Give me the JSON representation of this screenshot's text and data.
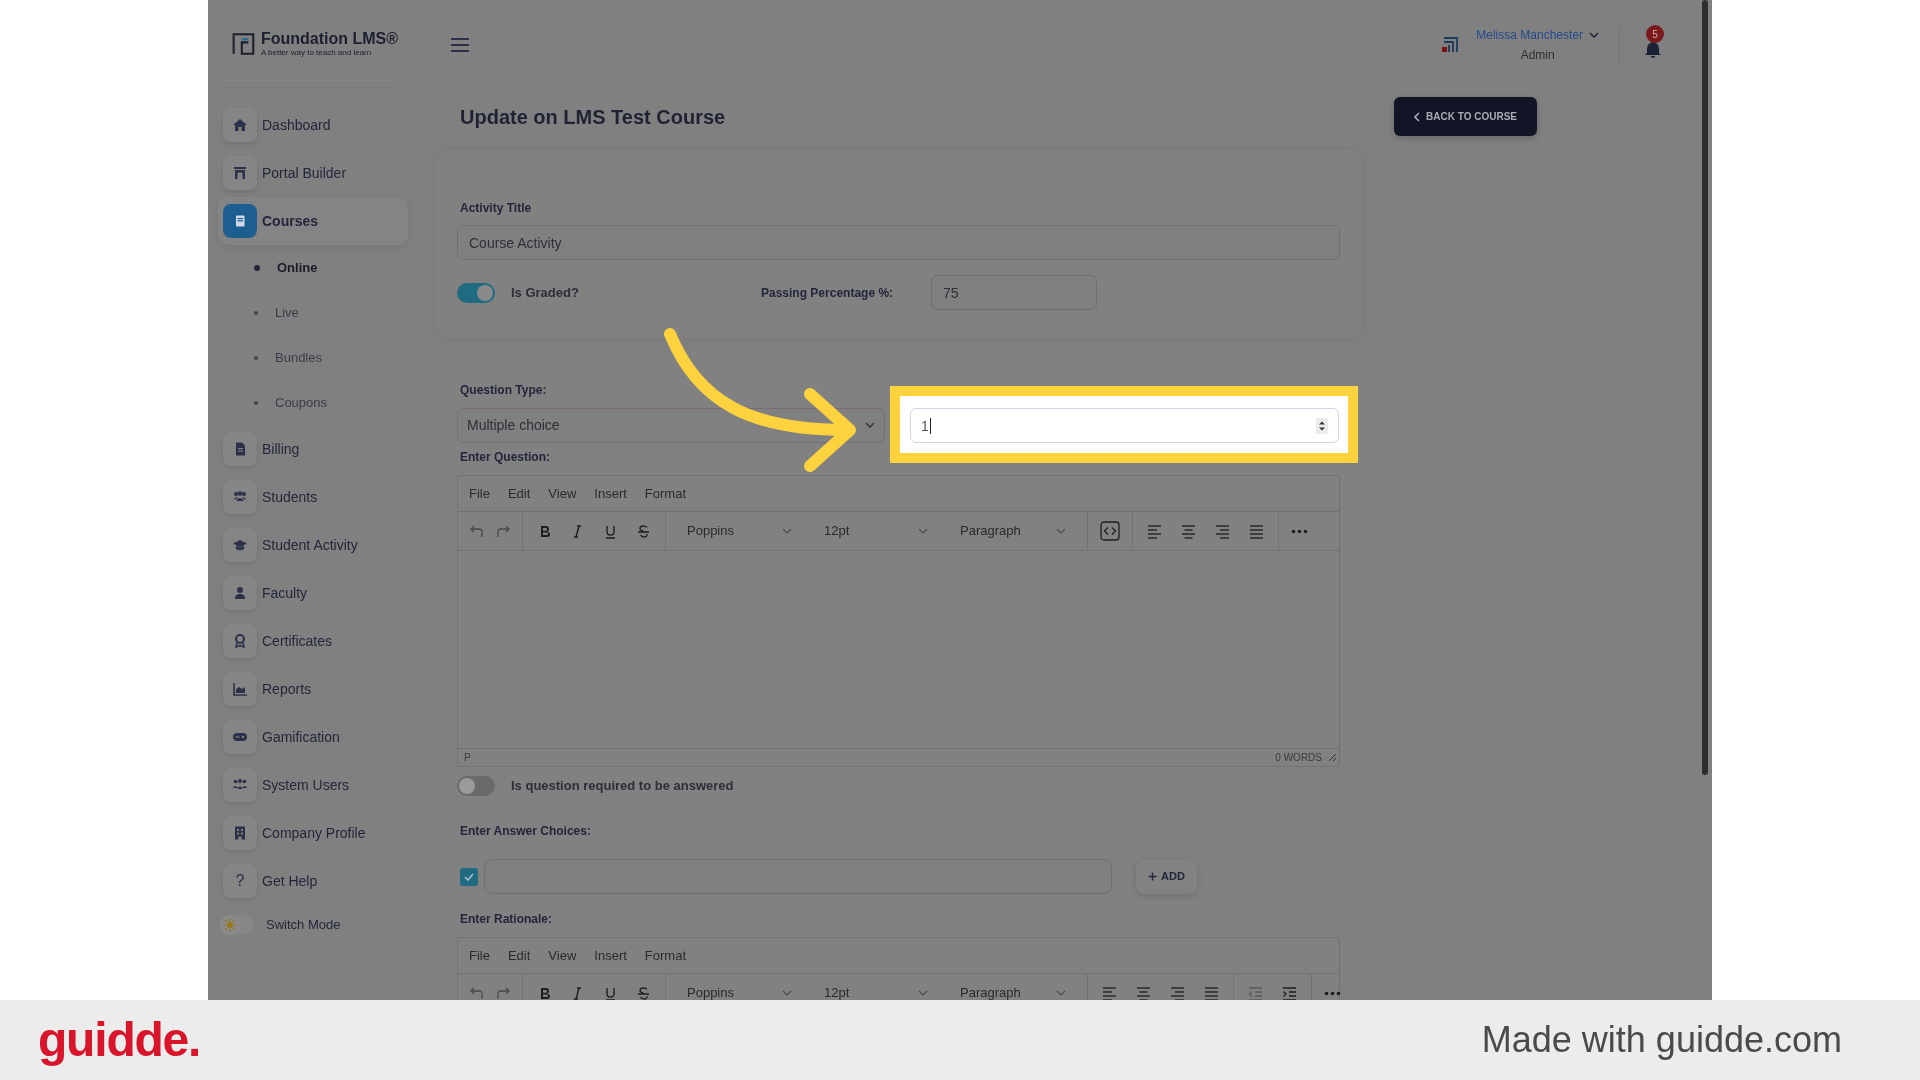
{
  "brand": {
    "name": "Foundation LMS®",
    "tagline": "A better way to teach and learn"
  },
  "sidebar": {
    "items": [
      {
        "label": "Dashboard",
        "selected": false
      },
      {
        "label": "Portal Builder",
        "selected": false
      },
      {
        "label": "Courses",
        "selected": true,
        "children": [
          {
            "label": "Online",
            "selected": true
          },
          {
            "label": "Live",
            "selected": false
          },
          {
            "label": "Bundles",
            "selected": false
          },
          {
            "label": "Coupons",
            "selected": false
          }
        ]
      },
      {
        "label": "Billing",
        "selected": false
      },
      {
        "label": "Students",
        "selected": false
      },
      {
        "label": "Student Activity",
        "selected": false
      },
      {
        "label": "Faculty",
        "selected": false
      },
      {
        "label": "Certificates",
        "selected": false
      },
      {
        "label": "Reports",
        "selected": false
      },
      {
        "label": "Gamification",
        "selected": false
      },
      {
        "label": "System Users",
        "selected": false
      },
      {
        "label": "Company Profile",
        "selected": false
      },
      {
        "label": "Get Help",
        "selected": false,
        "glyph": "?"
      }
    ],
    "switch_mode": {
      "label": "Switch Mode",
      "on": false
    }
  },
  "header": {
    "user_name": "Melissa Manchester",
    "user_role": "Admin",
    "notifications": "5"
  },
  "page": {
    "title": "Update on LMS Test Course",
    "back_button": "BACK TO COURSE"
  },
  "activity": {
    "title_label": "Activity Title",
    "title_value": "Course Activity",
    "graded_label": "Is Graded?",
    "graded_on": true,
    "passing_label": "Passing Percentage %:",
    "passing_value": "75"
  },
  "question": {
    "type_label": "Question Type:",
    "type_value": "Multiple choice",
    "points_value": "1",
    "question_label": "Enter Question:",
    "question_editor": {
      "menu": [
        "File",
        "Edit",
        "View",
        "Insert",
        "Format"
      ],
      "font": "Poppins",
      "size": "12pt",
      "block": "Paragraph",
      "path": "P",
      "word_count": "0 WORDS"
    },
    "required_label": "Is question required to be answered",
    "required_on": false,
    "choices_label": "Enter Answer Choices:",
    "choices": [
      {
        "checked": true
      }
    ],
    "add_button": "ADD",
    "rationale_label": "Enter Rationale:",
    "rationale_editor": {
      "menu": [
        "File",
        "Edit",
        "View",
        "Insert",
        "Format"
      ],
      "font": "Poppins",
      "size": "12pt",
      "block": "Paragraph"
    }
  },
  "footer": {
    "logo": "guidde.",
    "credit": "Made with guidde.com"
  }
}
